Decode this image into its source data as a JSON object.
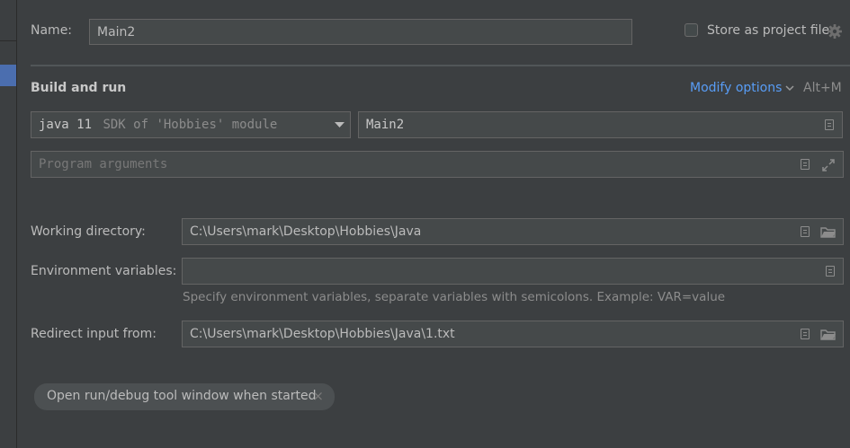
{
  "name_label": "Name:",
  "name_value": "Main2",
  "store_as_project_file": {
    "label": "Store as project file",
    "checked": false
  },
  "build_and_run": {
    "heading": "Build and run",
    "modify_options": "Modify options",
    "shortcut": "Alt+M",
    "sdk": {
      "version": "java 11",
      "description": "SDK of 'Hobbies' module"
    },
    "main_class": "Main2",
    "program_arguments_placeholder": "Program arguments"
  },
  "working_directory": {
    "label": "Working directory:",
    "value": "C:\\Users\\mark\\Desktop\\Hobbies\\Java"
  },
  "environment_variables": {
    "label": "Environment variables:",
    "value": "",
    "hint": "Specify environment variables, separate variables with semicolons. Example: VAR=value"
  },
  "redirect_input": {
    "label": "Redirect input from:",
    "value": "C:\\Users\\mark\\Desktop\\Hobbies\\Java\\1.txt"
  },
  "chip": {
    "label": "Open run/debug tool window when started",
    "close_glyph": "×"
  },
  "colors": {
    "background": "#3c3f41",
    "field_background": "#45494a",
    "field_border": "#646464",
    "link": "#589df6",
    "selected": "#4b6eaf"
  }
}
